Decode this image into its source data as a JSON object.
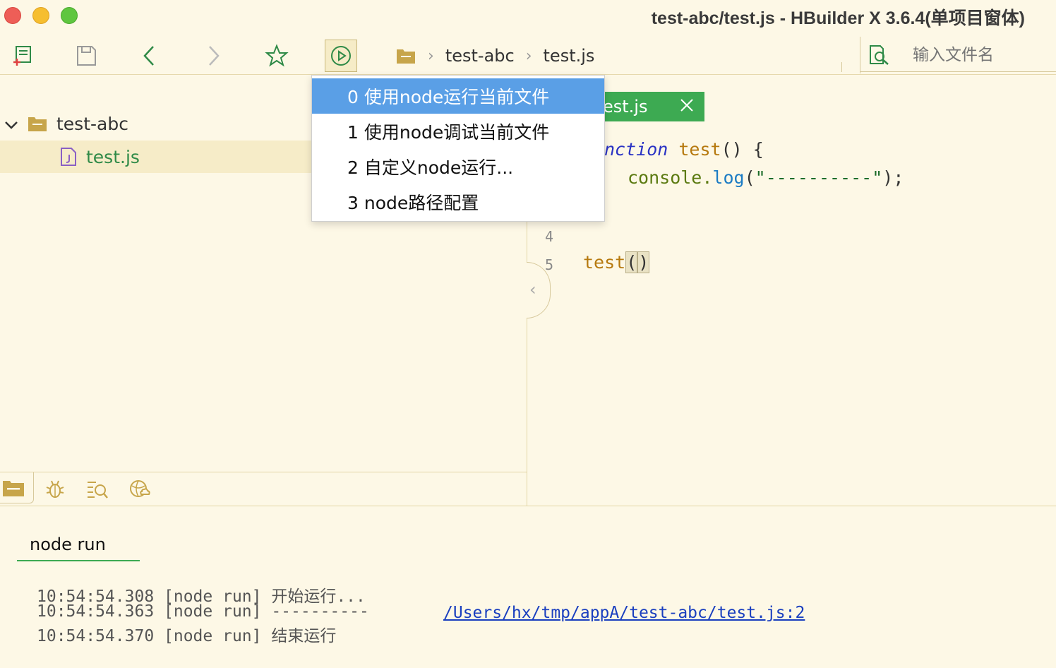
{
  "window": {
    "title": "test-abc/test.js - HBuilder X 3.6.4(单项目窗体)"
  },
  "toolbar": {
    "buttons": [
      "new-file-icon",
      "save-icon",
      "back-icon",
      "forward-icon",
      "favorite-star-icon",
      "run-icon"
    ],
    "breadcrumb": [
      "test-abc",
      "test.js"
    ],
    "search_placeholder": "输入文件名"
  },
  "project_tree": {
    "root": "test-abc",
    "file": "test.js"
  },
  "run_menu": {
    "items": [
      "0 使用node运行当前文件",
      "1 使用node调试当前文件",
      "2 自定义node运行...",
      "3 node路径配置"
    ],
    "selected_index": 0
  },
  "editor": {
    "tab_label": "est.js",
    "line1": {
      "kw": "nction",
      "fn": "test",
      "rest": "() {"
    },
    "line2": {
      "obj": "console",
      "dot": ".",
      "mth": "log",
      "open": "(",
      "str": "\"----------\"",
      "close": ");"
    },
    "line4_no": "4",
    "line5_no": "5",
    "line5": {
      "fn": "test",
      "open": "(",
      "close": ")"
    }
  },
  "console": {
    "tab_label": "node run",
    "lines": [
      "10:54:54.308 [node run] 开始运行...",
      "10:54:54.363 [node run] ----------",
      "10:54:54.370 [node run] 结束运行"
    ],
    "link": "/Users/hx/tmp/appA/test-abc/test.js:2"
  },
  "colors": {
    "background": "#fdf8e6",
    "accent_green": "#3daa52",
    "menu_selected": "#5a9fe6"
  }
}
